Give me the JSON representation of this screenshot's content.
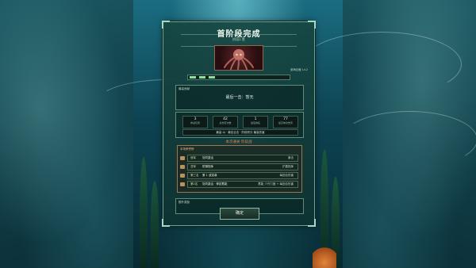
{
  "dialog": {
    "title": "首阶段完成",
    "subtitle": "阶段1 胜",
    "boss_caption": "深海巨鱿 Lv.2",
    "contribution": {
      "label": "最高贡献",
      "value": "最后一击：暂无"
    },
    "stats": [
      {
        "value": "3",
        "label": "参战玩家"
      },
      {
        "value": "42",
        "label": "总伤害次数"
      },
      {
        "value": "1",
        "label": "最佳排名"
      },
      {
        "value": "77",
        "label": "最高单次伤害"
      }
    ],
    "best_text": "最高 AJ · 最佳合击 · 阶段积分 最高伤害",
    "honor_title": "本次通关 阶段战",
    "honor": {
      "label": "本场荣誉榜",
      "rows": [
        {
          "rank": "冠军",
          "name": "协同激活",
          "desc": "暴击"
        },
        {
          "rank": "亚军",
          "name": "防御指挥",
          "desc": "护盾指挥"
        },
        {
          "rank": "第三名",
          "name": "第 1 波突袭",
          "desc": "每回合伤害"
        },
        {
          "rank": "第2名",
          "name": "协同激活 · 神技蓄能",
          "desc": "蓄能 少许力度 + 每回合伤害"
        }
      ]
    },
    "reward_label": "额外奖励",
    "confirm_label": "确定"
  },
  "colors": {
    "accent": "#8fe0a0",
    "honor_title": "#e77f55",
    "frame": "#6ea58e"
  }
}
